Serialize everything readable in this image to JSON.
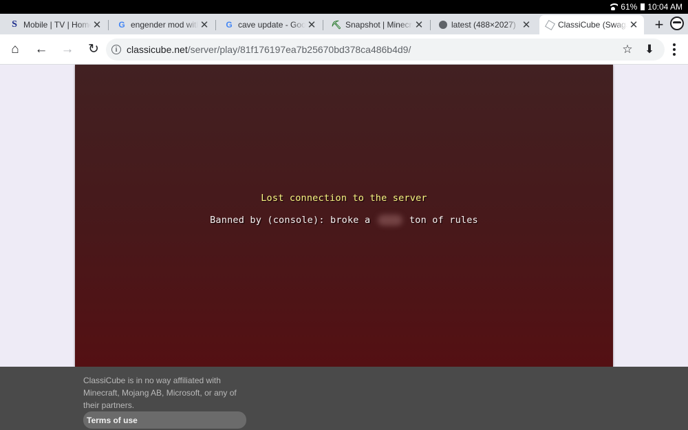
{
  "status_bar": {
    "battery": "61%",
    "time": "10:04 AM"
  },
  "tabs": [
    {
      "title": "Mobile | TV | Home Electronics",
      "favicon": "samsung-s-icon",
      "favicon_glyph": "S",
      "active": false
    },
    {
      "title": "engender mod without",
      "favicon": "google-g-icon",
      "favicon_glyph": "G",
      "active": false
    },
    {
      "title": "cave update - Google",
      "favicon": "google-g-icon",
      "favicon_glyph": "G",
      "active": false
    },
    {
      "title": "Snapshot | Minecraft",
      "favicon": "pickaxe-icon",
      "favicon_glyph": "⛏",
      "active": false
    },
    {
      "title": "latest (488×2027)",
      "favicon": "globe-icon",
      "favicon_glyph": "",
      "active": false
    },
    {
      "title": "ClassiCube (SwagJar",
      "favicon": "cube-icon",
      "favicon_glyph": "",
      "active": true
    }
  ],
  "tab_close_glyph": "✕",
  "new_tab_glyph": "+",
  "toolbar": {
    "home_glyph": "⌂",
    "back_glyph": "←",
    "forward_glyph": "→",
    "reload_glyph": "↻",
    "info_glyph": "i",
    "url_host": "classicube.net",
    "url_path": "/server/play/81f176197ea7b25670bd378ca486b4d9/",
    "star_glyph": "☆",
    "download_glyph": "⬇"
  },
  "game": {
    "title": "Lost connection to the server",
    "reason_before": "Banned by (console): broke a",
    "reason_after": "ton of rules",
    "title_color": "#f6f682"
  },
  "footer": {
    "disclaimer": "ClassiCube is in no way affiliated with Minecraft, Mojang AB, Microsoft, or any of their partners.",
    "terms_label": "Terms of use"
  }
}
